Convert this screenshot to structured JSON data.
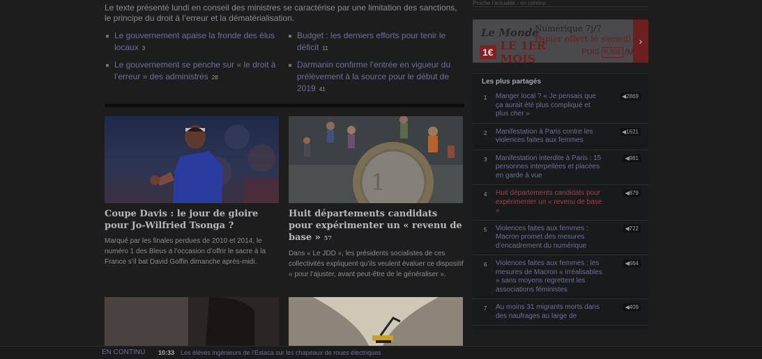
{
  "lead": {
    "text": "Le texte présenté lundi en conseil des ministres se caractérise par une limitation des sanctions, le principe du droit à l’erreur et la dématérialisation."
  },
  "links": [
    {
      "title": "Le gouvernement apaise la fronde des élus locaux",
      "count": "3"
    },
    {
      "title": "Le gouvernement se penche sur « le droit à l’erreur » des administrés",
      "count": "28"
    },
    {
      "title": "Budget : les derniers efforts pour tenir le déficit",
      "count": "11"
    },
    {
      "title": "Darmanin confirme l’entrée en vigueur du prélèvement à la source pour le début de 2019",
      "count": "41"
    }
  ],
  "cards": [
    {
      "title": "Coupe Davis : le jour de gloire pour Jo-Wilfried Tsonga ?",
      "text": "Marqué par les finales perdues de 2010 et 2014, le numéro 1 des Bleus a l’occasion d’offrir le sacre à la France s’il bat David Goffin dimanche après-midi."
    },
    {
      "title": "Huit départements candidats pour expérimenter un « revenu de base »",
      "count": "57",
      "text": "Dans « Le JDD », les présidents socialistes de ces collectivités expliquent qu’ils veulent évaluer ce dispositif « pour l’ajuster, avant peut-être de le généraliser »."
    }
  ],
  "sidebar": {
    "top_text": "Proche l’actualité - en continu",
    "ad": {
      "logo": "Le Monde",
      "product": "Numérique 7j/7",
      "offer": "Papier offert le samedi",
      "price_red": "1€",
      "price_big": "LE 1ER MOIS",
      "puis": "PUIS",
      "price_after": "9,90€",
      "per": "/MOIS",
      "arrow": "›"
    },
    "shared_heading": "Les plus partagés",
    "shared": [
      {
        "n": "1",
        "title": "Manger local ? « Je pensais que ça aurait été plus compliqué et plus cher »",
        "count": "2869",
        "hot": false
      },
      {
        "n": "2",
        "title": "Manifestation à Paris contre les violences faites aux femmes",
        "count": "1621",
        "hot": false
      },
      {
        "n": "3",
        "title": "Manifestation interdite à Paris : 15 personnes interpellées et placées en garde à vue",
        "count": "981",
        "hot": false
      },
      {
        "n": "4",
        "title": "Huit départements candidats pour expérimenter un « revenu de base »",
        "count": "879",
        "hot": true
      },
      {
        "n": "5",
        "title": "Violences faites aux femmes : Macron promet des mesures d’encadrement du numérique",
        "count": "722",
        "hot": false
      },
      {
        "n": "6",
        "title": "Violences faites aux femmes : les mesures de Macron « irréalisables » sans moyens regrettent les associations féministes",
        "count": "664",
        "hot": false
      },
      {
        "n": "7",
        "title": "Au moins 31 migrants morts dans des naufrages au large de",
        "count": "409",
        "hot": false
      }
    ]
  },
  "ticker": {
    "label": "EN CONTINU",
    "time": "10:33",
    "text": "Les élèves ingénieurs de l’Estaca sur les chapeaux de roues électriques"
  }
}
